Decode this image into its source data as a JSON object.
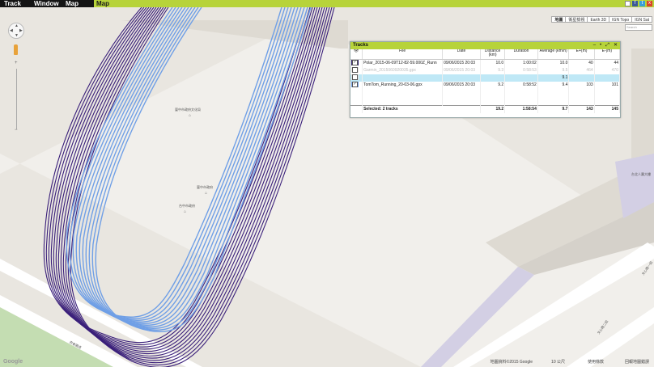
{
  "menubar": {
    "items": [
      "Track",
      "Window",
      "Map"
    ],
    "active_tab": "Map"
  },
  "map": {
    "types": [
      "地圖",
      "衛星檢視",
      "Earth 3D",
      "IGN Topo",
      "IGN Sat"
    ],
    "search_placeholder": "Search",
    "poi": [
      "臺中市政府文化局",
      "臺中市政府",
      "台中市政府",
      "台北人壽大樓",
      "文心路一段",
      "文心路二段",
      "府會園道"
    ],
    "attribution": "地圖資料©2015 Google",
    "scale": "10 公尺",
    "terms": "使用條款",
    "report": "回報地圖錯誤",
    "logo": "Google",
    "colors": {
      "track_dark": "#3a1f7a",
      "track_light": "#6f9fe6",
      "menubar": "#b7d33a"
    }
  },
  "tracks_panel": {
    "title": "Tracks",
    "columns": [
      "",
      "File",
      "Date",
      "Distance (km)",
      "Duration",
      "Average (km/h)",
      "E+(m)",
      "E-(m)"
    ],
    "rows": [
      {
        "checked": true,
        "color": "#2b1a6a",
        "file": "Polar_2015-06-09T12-82-59.000Z_Runn",
        "date": "09/06/2015 20:03",
        "distance": "10.0",
        "duration": "1:00:02",
        "average": "10.0",
        "eplus": "40",
        "eminus": "44",
        "style": "sel-row"
      },
      {
        "checked": false,
        "color": "#e0e0e0",
        "file": "Garmin_2015060920035.gpx",
        "date": "09/06/2015 20:03",
        "distance": "9.3",
        "duration": "0:58:53",
        "average": "9.5",
        "eplus": "464",
        "eminus": "470",
        "style": "dim"
      },
      {
        "checked": false,
        "color": "#e0e0e0",
        "file": "",
        "date": "",
        "distance": "",
        "duration": "",
        "average": "9.1",
        "eplus": "",
        "eminus": "",
        "style": "hl"
      },
      {
        "checked": true,
        "color": "#6f9fe6",
        "file": "TomTom_Running_20-03-06.gpx",
        "date": "09/06/2015 20:03",
        "distance": "9.2",
        "duration": "0:58:52",
        "average": "9.4",
        "eplus": "103",
        "eminus": "101",
        "style": "sel-row"
      }
    ],
    "summary": {
      "label": "Selected: 2 tracks",
      "distance": "19.2",
      "duration": "1:58:54",
      "average": "9.7",
      "eplus": "143",
      "eminus": "145"
    }
  }
}
